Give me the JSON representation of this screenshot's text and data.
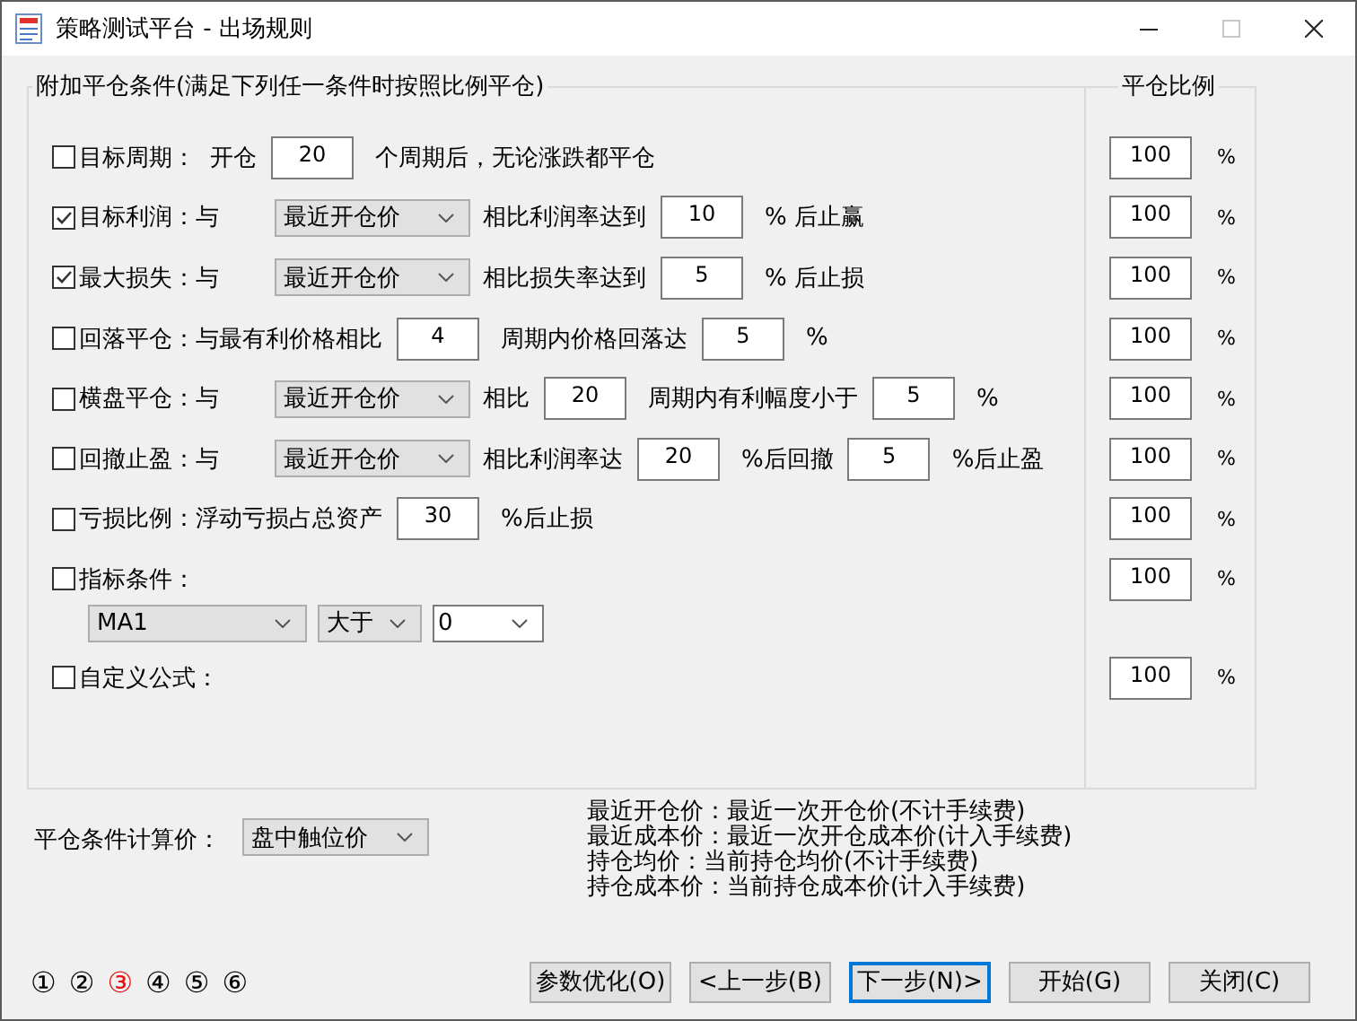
{
  "window": {
    "title": "策略测试平台 - 出场规则",
    "controls": [
      {
        "kind": "minimize",
        "disabled": false
      },
      {
        "kind": "maximize",
        "disabled": true
      },
      {
        "kind": "close",
        "disabled": false
      }
    ]
  },
  "conditions_group": {
    "title": "附加平仓条件(满足下列任一条件时按照比例平仓)"
  },
  "ratio_group": {
    "title": "平仓比例"
  },
  "conditions": [
    {
      "checked": false,
      "label": "目标周期：",
      "parts": [
        {
          "kind": "text",
          "text": "开仓"
        },
        {
          "kind": "input",
          "value": "20"
        },
        {
          "kind": "text",
          "text": "个周期后，无论涨跌都平仓"
        }
      ],
      "ratio": "100",
      "ratio_unit": "%"
    },
    {
      "checked": true,
      "label": "目标利润：与",
      "parts": [
        {
          "kind": "select",
          "value": "最近开仓价"
        },
        {
          "kind": "text",
          "text": "相比利润率达到"
        },
        {
          "kind": "input",
          "value": "10"
        },
        {
          "kind": "text",
          "text": "% 后止赢"
        }
      ],
      "ratio": "100",
      "ratio_unit": "%"
    },
    {
      "checked": true,
      "label": "最大损失：与",
      "parts": [
        {
          "kind": "select",
          "value": "最近开仓价"
        },
        {
          "kind": "text",
          "text": "相比损失率达到"
        },
        {
          "kind": "input",
          "value": "5"
        },
        {
          "kind": "text",
          "text": "% 后止损"
        }
      ],
      "ratio": "100",
      "ratio_unit": "%"
    },
    {
      "checked": false,
      "label": "回落平仓：与最有利价格相比",
      "parts": [
        {
          "kind": "input",
          "value": "4"
        },
        {
          "kind": "text",
          "text": "周期内价格回落达"
        },
        {
          "kind": "input",
          "value": "5"
        },
        {
          "kind": "text",
          "text": "%"
        }
      ],
      "ratio": "100",
      "ratio_unit": "%"
    },
    {
      "checked": false,
      "label": "横盘平仓：与",
      "parts": [
        {
          "kind": "select",
          "value": "最近开仓价"
        },
        {
          "kind": "text",
          "text": "相比"
        },
        {
          "kind": "input",
          "value": "20"
        },
        {
          "kind": "text",
          "text": "周期内有利幅度小于"
        },
        {
          "kind": "input",
          "value": "5"
        },
        {
          "kind": "text",
          "text": "%"
        }
      ],
      "ratio": "100",
      "ratio_unit": "%"
    },
    {
      "checked": false,
      "label": "回撤止盈：与",
      "parts": [
        {
          "kind": "select",
          "value": "最近开仓价"
        },
        {
          "kind": "text",
          "text": "相比利润率达"
        },
        {
          "kind": "input",
          "value": "20"
        },
        {
          "kind": "text",
          "text": "%后回撤"
        },
        {
          "kind": "input",
          "value": "5"
        },
        {
          "kind": "text",
          "text": "%后止盈"
        }
      ],
      "ratio": "100",
      "ratio_unit": "%"
    },
    {
      "checked": false,
      "label": "亏损比例：浮动亏损占总资产",
      "parts": [
        {
          "kind": "input",
          "value": "30"
        },
        {
          "kind": "text",
          "text": "%后止损"
        }
      ],
      "ratio": "100",
      "ratio_unit": "%"
    },
    {
      "checked": false,
      "label": "指标条件：",
      "sub_parts": [
        {
          "kind": "select",
          "value": "MA1"
        },
        {
          "kind": "select",
          "value": "大于"
        },
        {
          "kind": "combo",
          "value": "0"
        }
      ],
      "ratio": "100",
      "ratio_unit": "%"
    },
    {
      "checked": false,
      "label": "自定义公式：",
      "ratio": "100",
      "ratio_unit": "%"
    }
  ],
  "calc_price": {
    "label": "平仓条件计算价：",
    "value": "盘中触位价"
  },
  "notes": [
    "最近开仓价：最近一次开仓价(不计手续费)",
    "最近成本价：最近一次开仓成本价(计入手续费)",
    "持仓均价：当前持仓均价(不计手续费)",
    "持仓成本价：当前持仓成本价(计入手续费)"
  ],
  "steps": [
    {
      "label": "①",
      "selected": false
    },
    {
      "label": "②",
      "selected": false
    },
    {
      "label": "③",
      "selected": true
    },
    {
      "label": "④",
      "selected": false
    },
    {
      "label": "⑤",
      "selected": false
    },
    {
      "label": "⑥",
      "selected": false
    }
  ],
  "buttons": [
    {
      "label": "参数优化(O)",
      "focused": false
    },
    {
      "label": "<上一步(B)",
      "focused": false
    },
    {
      "label": "下一步(N)>",
      "focused": true
    },
    {
      "label": "开始(G)",
      "focused": false
    },
    {
      "label": "关闭(C)",
      "focused": false
    }
  ]
}
